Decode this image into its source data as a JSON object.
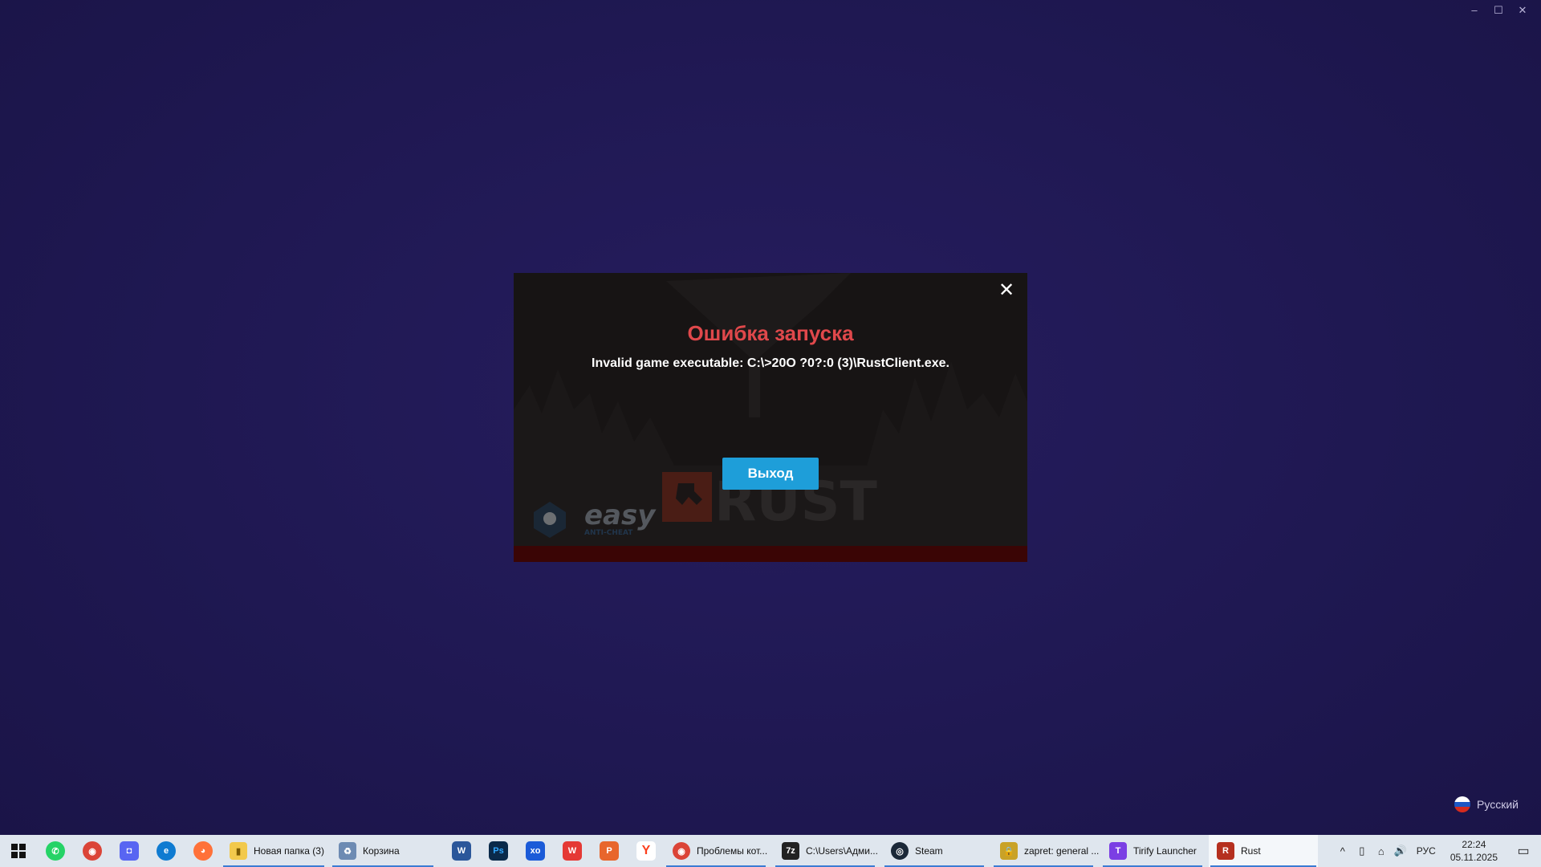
{
  "window": {
    "minimize_glyph": "–",
    "maximize_glyph": "☐",
    "close_glyph": "✕"
  },
  "dialog": {
    "title": "Ошибка запуска",
    "message": "Invalid game executable: C:\\>20O ?0?:0 (3)\\RustClient.exe.",
    "exit_button": "Выход",
    "close_glyph": "✕",
    "background_logos": [
      "easy",
      "ANTI-CHEAT",
      "RUST"
    ],
    "colors": {
      "title": "#e0484b",
      "button": "#1e9ed9",
      "bottom_bar": "#3a0505"
    }
  },
  "language_indicator": {
    "label": "Русский"
  },
  "taskbar": {
    "pinned": [
      {
        "name": "whatsapp-icon",
        "glyph": "✆",
        "color": "#25d366"
      },
      {
        "name": "chrome-icon",
        "glyph": "◉",
        "color": "#db4437"
      },
      {
        "name": "discord-like-icon",
        "glyph": "◘",
        "color": "#5865f2"
      },
      {
        "name": "edge-icon",
        "glyph": "e",
        "color": "#0f7bd1"
      },
      {
        "name": "firefox-icon",
        "glyph": "◕",
        "color": "#ff7139"
      }
    ],
    "tasks_left": [
      {
        "name": "folder-icon",
        "label": "Новая папка (3)",
        "glyph": "▮",
        "color": "#f2c94c"
      },
      {
        "name": "recycle-bin-icon",
        "label": "Корзина",
        "glyph": "♻",
        "color": "#6d8bb3"
      }
    ],
    "pinned2": [
      {
        "name": "word-icon",
        "glyph": "W",
        "color": "#2b579a"
      },
      {
        "name": "photoshop-icon",
        "glyph": "Ps",
        "color": "#0a2a4a"
      },
      {
        "name": "xbox-app-icon",
        "glyph": "xo",
        "color": "#1b5bd8"
      },
      {
        "name": "wps-icon",
        "glyph": "W",
        "color": "#e53935"
      },
      {
        "name": "wps-presentation-icon",
        "glyph": "P",
        "color": "#e8662c"
      },
      {
        "name": "yandex-icon",
        "glyph": "Y",
        "color": "#fc3f1d"
      }
    ],
    "tasks_right": [
      {
        "name": "chrome-task-icon",
        "label": "Проблемы кот...",
        "glyph": "◉",
        "color": "#db4437"
      },
      {
        "name": "7zip-icon",
        "label": "C:\\Users\\Адми...",
        "glyph": "7z",
        "color": "#222222"
      },
      {
        "name": "steam-icon",
        "label": "Steam",
        "glyph": "◎",
        "color": "#1b2838"
      },
      {
        "name": "lock-icon",
        "label": "zapret: general ...",
        "glyph": "🔒",
        "color": "#c9a227"
      },
      {
        "name": "tirify-icon",
        "label": "Tirify Launcher",
        "glyph": "T",
        "color": "#7b3fe4"
      },
      {
        "name": "rust-icon",
        "label": "Rust",
        "glyph": "R",
        "color": "#b5301f"
      }
    ],
    "tray": {
      "chevron": "^",
      "usb_glyph": "▯",
      "network_glyph": "⌂",
      "volume_glyph": "🔊",
      "language": "РУС",
      "time": "22:24",
      "date": "05.11.2025",
      "notification_glyph": "▭"
    }
  }
}
